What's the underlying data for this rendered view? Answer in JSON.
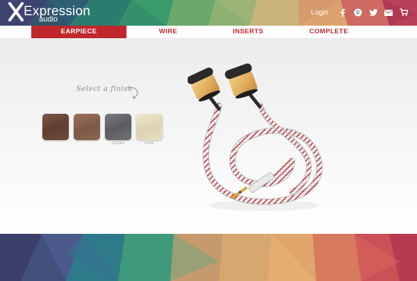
{
  "header": {
    "brand": "Expression",
    "brand_sub": "audio",
    "login_label": "Login",
    "social_icons": [
      "facebook-icon",
      "pinterest-icon",
      "twitter-icon",
      "mail-icon",
      "cart-icon"
    ]
  },
  "tabs": [
    {
      "label": "EARPIECE",
      "active": true
    },
    {
      "label": "WIRE",
      "active": false
    },
    {
      "label": "INSERTS",
      "active": false
    },
    {
      "label": "COMPLETE",
      "active": false
    }
  ],
  "main": {
    "finish_prompt": "Select a finish",
    "swatches": [
      {
        "label": "",
        "color": "#6b4a3a"
      },
      {
        "label": "",
        "color": "#8c6552"
      },
      {
        "label": "ZEBRA",
        "color": "#6c6d70"
      },
      {
        "label": "PINE",
        "color": "#e6ddc0"
      }
    ]
  },
  "colors": {
    "accent": "#c0272d",
    "tab_text": "#c0272d",
    "background_top": "#ececec"
  }
}
